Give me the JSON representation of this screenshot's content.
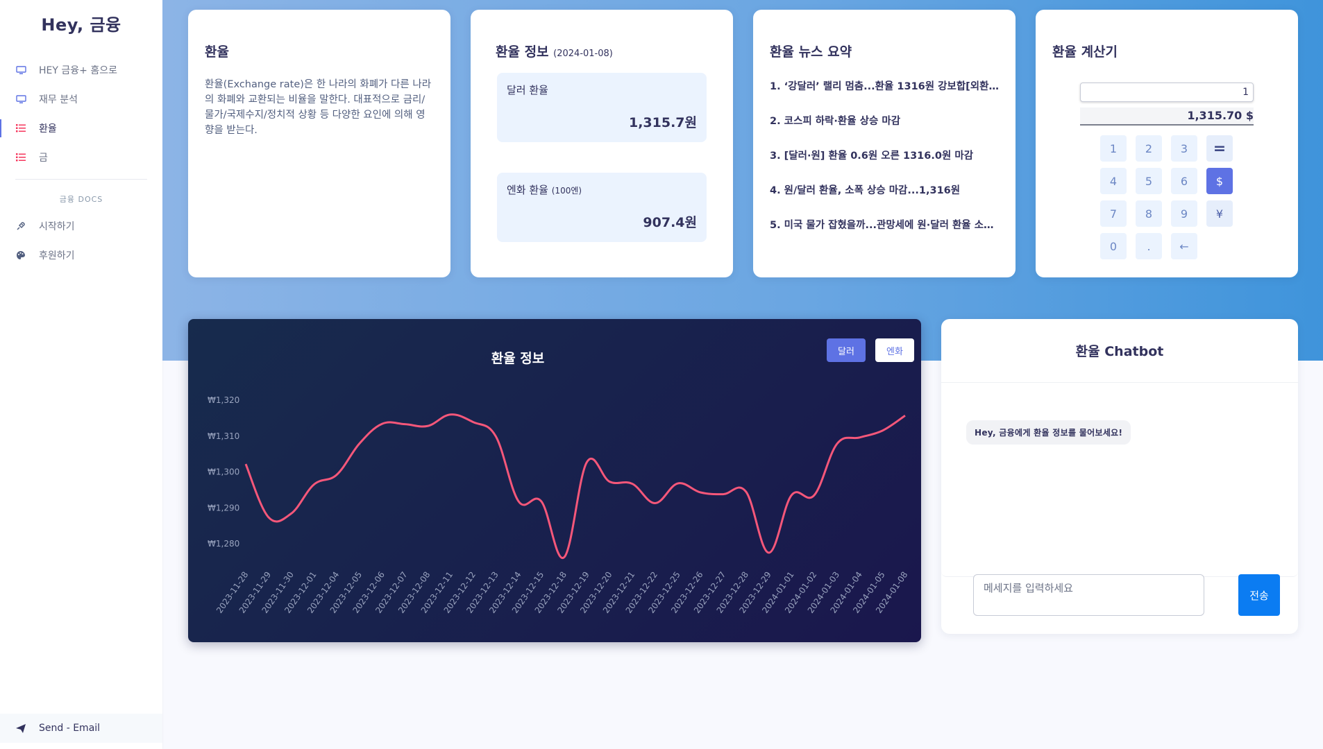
{
  "sidebar": {
    "brand": "Hey, 금융",
    "items": [
      {
        "label": "HEY 금융+ 홈으로",
        "icon": "monitor-icon"
      },
      {
        "label": "재무 분석",
        "icon": "monitor-icon"
      },
      {
        "label": "환율",
        "icon": "list-icon"
      },
      {
        "label": "금",
        "icon": "list-icon"
      }
    ],
    "docs_heading": "금융 DOCS",
    "docs_items": [
      {
        "label": "시작하기",
        "icon": "rocket-icon"
      },
      {
        "label": "후원하기",
        "icon": "palette-icon"
      }
    ],
    "send_email": "Send - Email"
  },
  "cards": {
    "about": {
      "title": "환율",
      "description": "환율(Exchange rate)은 한 나라의 화폐가 다른 나라의 화폐와 교환되는 비율을 말한다. 대표적으로 금리/물가/국제수지/정치적 상황 등 다양한 요인에 의해 영향을 받는다."
    },
    "info": {
      "title": "환율 정보",
      "date": "(2024-01-08)",
      "dollar_label": "달러 환율",
      "dollar_value": "1,315.7원",
      "yen_label": "엔화 환율",
      "yen_unit": "(100엔)",
      "yen_value": "907.4원"
    },
    "news": {
      "title": "환율 뉴스 요약",
      "items": [
        "1. ‘강달러’ 랠리 멈춤...환율 1316원 강보합[외환마감]",
        "2. 코스피 하락·환율 상승 마감",
        "3. [달러·원] 환율 0.6원 오른 1316.0원 마감",
        "4. 원/달러 환율, 소폭 상승 마감...1,316원",
        "5. 미국 물가 잡혔을까...관망세에 원·달러 환율 소폭 상승"
      ]
    },
    "calculator": {
      "title": "환율 계산기",
      "input_value": "1",
      "result": "1,315.70 $",
      "keys": [
        "1",
        "2",
        "3",
        "=",
        "4",
        "5",
        "6",
        "$",
        "7",
        "8",
        "9",
        "¥",
        "0",
        ".",
        "←"
      ]
    }
  },
  "chart": {
    "toggle_dollar": "달러",
    "toggle_yen": "엔화"
  },
  "chart_data": {
    "type": "line",
    "title": "환율 정보",
    "color": "#f5577a",
    "x": [
      "2023-11-28",
      "2023-11-29",
      "2023-11-30",
      "2023-12-01",
      "2023-12-04",
      "2023-12-05",
      "2023-12-06",
      "2023-12-07",
      "2023-12-08",
      "2023-12-11",
      "2023-12-12",
      "2023-12-13",
      "2023-12-14",
      "2023-12-15",
      "2023-12-18",
      "2023-12-19",
      "2023-12-20",
      "2023-12-21",
      "2023-12-22",
      "2023-12-25",
      "2023-12-26",
      "2023-12-27",
      "2023-12-28",
      "2023-12-29",
      "2024-01-01",
      "2024-01-02",
      "2024-01-03",
      "2024-01-04",
      "2024-01-05",
      "2024-01-08"
    ],
    "series": [
      {
        "values": [
          1302.2,
          1287.4,
          1288.4,
          1296.5,
          1299.2,
          1307.9,
          1313.4,
          1313.3,
          1312.8,
          1316.0,
          1313.9,
          1309.9,
          1291.8,
          1291.8,
          1276.2,
          1302.7,
          1297.3,
          1296.7,
          1291.3,
          1296.8,
          1294.3,
          1293.8,
          1294.5,
          1277.5,
          1293.5,
          1293.5,
          1307.8,
          1309.6,
          1311.5,
          1315.7
        ]
      }
    ],
    "yticks": [
      "₩1,320",
      "₩1,310",
      "₩1,300",
      "₩1,290",
      "₩1,280"
    ],
    "ylim": [
      1280,
      1320
    ]
  },
  "chat": {
    "title": "환율 Chatbot",
    "greeting": "Hey, 금융에게 환율 정보를 물어보세요!",
    "placeholder": "메세지를 입력하세요",
    "send": "전송"
  }
}
